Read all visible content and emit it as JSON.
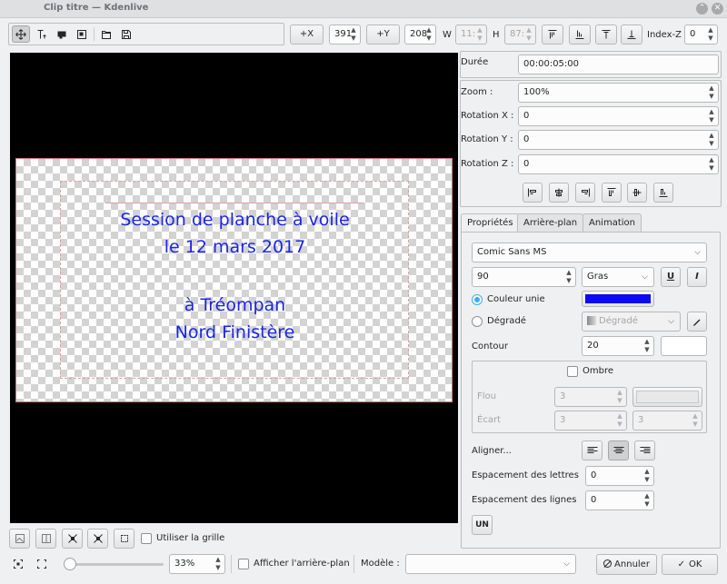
{
  "window": {
    "title": "Clip titre — Kdenlive",
    "close_symbol": "✕",
    "restore_symbol": "⌃"
  },
  "toolbar": {
    "x_button": "+X",
    "x_value": "391",
    "y_button": "+Y",
    "y_value": "208",
    "w_label": "W",
    "w_value": "11:",
    "h_label": "H",
    "h_value": "87:",
    "zindex_label": "Index-Z",
    "zindex_value": "0"
  },
  "canvas": {
    "text_color": "#1b24e8",
    "lines": [
      "Session de planche à voile",
      "le 12 mars 2017",
      "",
      "à Tréompan",
      "Nord Finistère"
    ]
  },
  "props": {
    "duration_label": "Durée",
    "duration_value": "00:00:05:00",
    "zoom_label": "Zoom :",
    "zoom_value": "100%",
    "rotx_label": "Rotation X :",
    "rotx_value": "0",
    "roty_label": "Rotation Y :",
    "roty_value": "0",
    "rotz_label": "Rotation Z :",
    "rotz_value": "0"
  },
  "tabs": [
    "Propriétés",
    "Arrière-plan",
    "Animation"
  ],
  "text_props": {
    "font": "Comic Sans MS",
    "size": "90",
    "weight": "Gras",
    "underline": "U",
    "italic": "I",
    "solid_color_label": "Couleur unie",
    "solid_color": "#0a0af0",
    "gradient_label": "Dégradé",
    "gradient_value": "Dégradé",
    "outline_label": "Contour",
    "outline_value": "20",
    "shadow_label": "Ombre",
    "blur_label": "Flou",
    "blur_value": "3",
    "offset_label": "Écart",
    "offset_x": "3",
    "offset_y": "3",
    "align_label": "Aligner...",
    "letter_spacing_label": "Espacement des lettres",
    "letter_spacing_value": "0",
    "line_spacing_label": "Espacement des lignes",
    "line_spacing_value": "0",
    "un_label": "UN"
  },
  "bottom": {
    "grid_label": "Utiliser la grille",
    "zoom_value": "33%",
    "bg_label": "Afficher l'arrière-plan",
    "template_label": "Modèle :",
    "template_value": "",
    "cancel_label": "Annuler",
    "ok_label": "OK"
  }
}
